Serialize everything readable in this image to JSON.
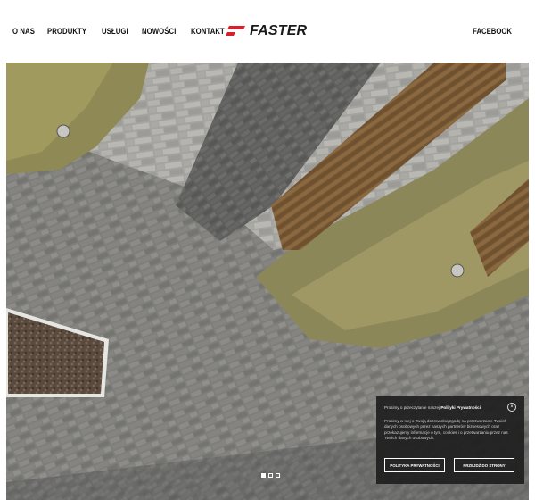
{
  "nav": {
    "items": [
      "O NAS",
      "PRODUKTY",
      "USŁUGI",
      "NOWOŚCI",
      "KONTAKT"
    ]
  },
  "logo": {
    "text": "FASTER",
    "mark_color": "#d8202a"
  },
  "social": {
    "facebook": "FACEBOOK"
  },
  "hero": {
    "slider": {
      "slide_count": 3,
      "active_index": 0
    }
  },
  "consent": {
    "intro_prefix": "Prosimy o przeczytanie naszej",
    "intro_link": "Polityki Prywatności",
    "intro_suffix": ".",
    "body": "Prosimy w niej o Twoją dobrowolną zgodę na przetwarzanie Twoich danych osobowych przez naszych partnerów biznesowych oraz przekazujemy informacje o tym, cookies i o przetwarzaniu przez nas Twoich danych osobowych.",
    "policy_button": "POLITYKA PRYWATNOŚCI",
    "accept_button": "PRZEJDŹ DO STRONY",
    "close_symbol": "×"
  }
}
